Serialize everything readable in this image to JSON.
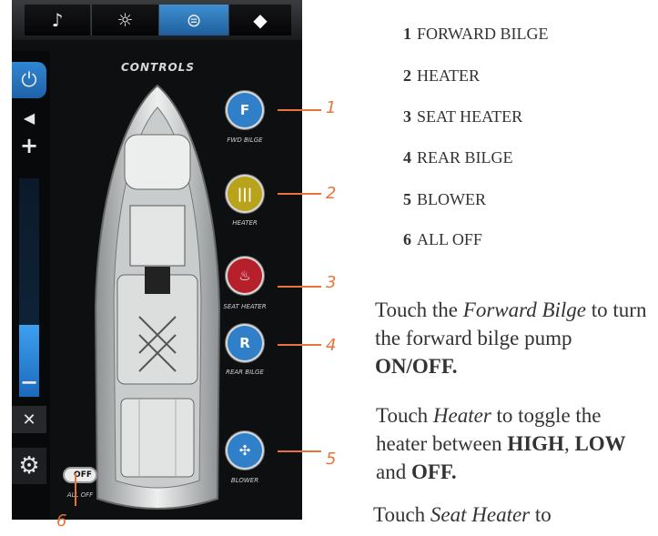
{
  "screen": {
    "title": "CONTROLS",
    "tabs": [
      {
        "icon": "music-note-icon",
        "glyph": "♪"
      },
      {
        "icon": "brightness-icon",
        "glyph": "☼"
      },
      {
        "icon": "toggle-switches-icon",
        "glyph": "⊜"
      },
      {
        "icon": "android-icon",
        "glyph": "◆"
      }
    ],
    "active_tab": 2,
    "sidebar": {
      "power_glyph": "⏻",
      "volume_up_glyph": "+",
      "volume_down_glyph": "−",
      "speaker_glyph": "◀",
      "mute_glyph": "✕",
      "settings_glyph": "⚙",
      "volume_level": 0.33
    },
    "controls": [
      {
        "label": "FWD BILGE",
        "badge": "F",
        "color": "#2f7fc9"
      },
      {
        "label": "HEATER",
        "badge": "|||",
        "color": "#b8a31a"
      },
      {
        "label": "SEAT HEATER",
        "badge": "♨",
        "color": "#b5202a"
      },
      {
        "label": "REAR BILGE",
        "badge": "R",
        "color": "#2f7fc9"
      },
      {
        "label": "BLOWER",
        "badge": "✣",
        "color": "#2f7fc9"
      }
    ],
    "all_off": {
      "label": "ALL OFF",
      "switch_text": "OFF"
    }
  },
  "callouts": [
    "1",
    "2",
    "3",
    "4",
    "5",
    "6"
  ],
  "legend": [
    {
      "num": "1",
      "text": "FORWARD BILGE"
    },
    {
      "num": "2",
      "text": "HEATER"
    },
    {
      "num": "3",
      "text": "SEAT HEATER"
    },
    {
      "num": "4",
      "text": "REAR BILGE"
    },
    {
      "num": "5",
      "text": "BLOWER"
    },
    {
      "num": "6",
      "text": "ALL OFF"
    }
  ],
  "paragraphs": {
    "p1": {
      "a": "Touch the ",
      "em": "Forward Bilge",
      "b": " to turn the forward bilge pump ",
      "strong": "ON/OFF."
    },
    "p2": {
      "a": "Touch ",
      "em": "Heater",
      "b": " to toggle the heater between ",
      "s1": "HIGH",
      "c": ", ",
      "s2": "LOW",
      "d": " and ",
      "s3": "OFF."
    },
    "p3": {
      "a": "Touch ",
      "em": "Seat Heater",
      "b": " to"
    }
  },
  "colors": {
    "accent_blue": "#2f86d3",
    "callout_orange": "#e8743b"
  }
}
